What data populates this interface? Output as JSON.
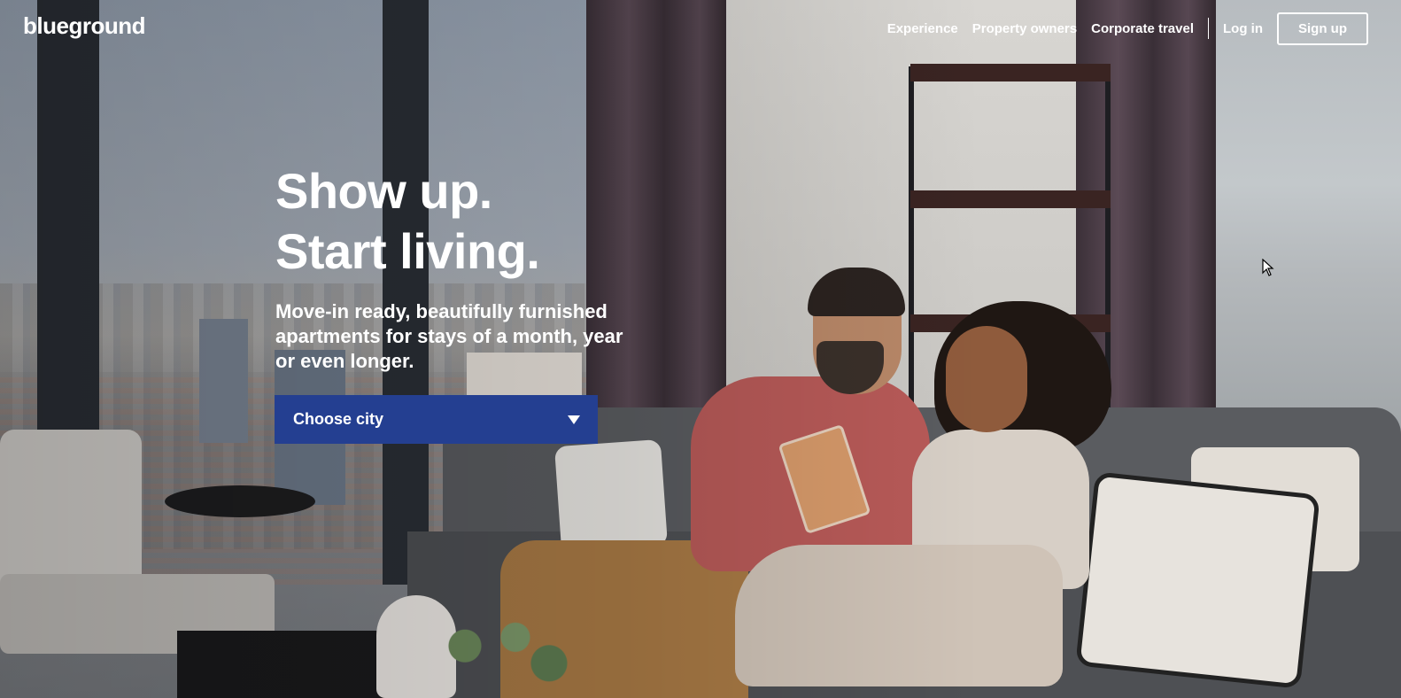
{
  "brand": {
    "logo_text": "blueground"
  },
  "nav": {
    "items": [
      "Experience",
      "Property owners",
      "Corporate travel"
    ],
    "login": "Log in",
    "signup": "Sign up"
  },
  "hero": {
    "title_line1": "Show up.",
    "title_line2": "Start living.",
    "subtitle": "Move-in ready, beautifully furnished apartments for stays of a month, year or even longer.",
    "city_select": {
      "label": "Choose city",
      "icon": "chevron-down-icon"
    }
  },
  "colors": {
    "accent": "#243f91",
    "text": "#ffffff"
  }
}
